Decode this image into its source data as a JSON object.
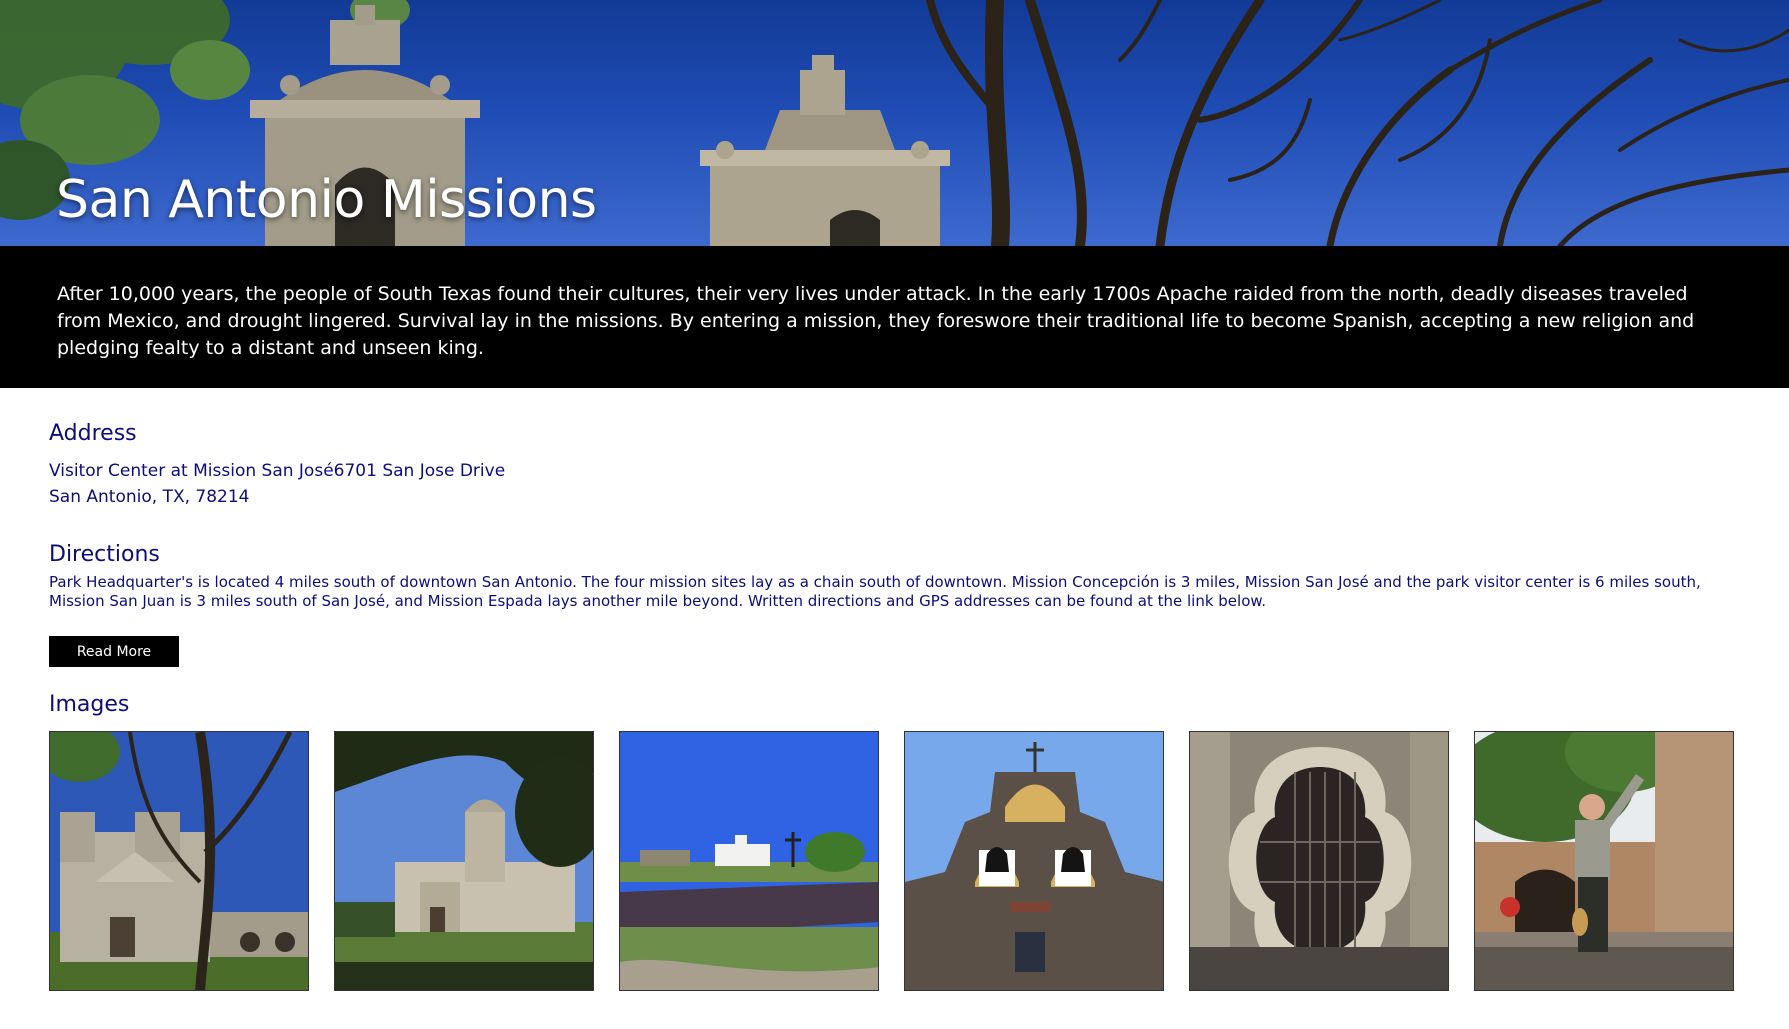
{
  "hero": {
    "title": "San Antonio Missions"
  },
  "intro": {
    "text": "After 10,000 years, the people of South Texas found their cultures, their very lives under attack. In the early 1700s Apache raided from the north, deadly diseases traveled from Mexico, and drought lingered. Survival lay in the missions. By entering a mission, they foreswore their traditional life to become Spanish, accepting a new religion and pledging fealty to a distant and unseen king."
  },
  "address": {
    "heading": "Address",
    "line1": "Visitor Center at Mission San José6701 San Jose Drive",
    "line2": "San Antonio, TX, 78214"
  },
  "directions": {
    "heading": "Directions",
    "text": "Park Headquarter's is located 4 miles south of downtown San Antonio. The four mission sites lay as a chain south of downtown. Mission Concepción is 3 miles, Mission San José and the park visitor center is 6 miles south, Mission San Juan is 3 miles south of San José, and Mission Espada lays another mile beyond. Written directions and GPS addresses can be found at the link below.",
    "button_label": "Read More"
  },
  "images": {
    "heading": "Images"
  },
  "colors": {
    "heading_text": "#0d0d7a",
    "intro_background": "#000000",
    "button_background": "#000000"
  }
}
